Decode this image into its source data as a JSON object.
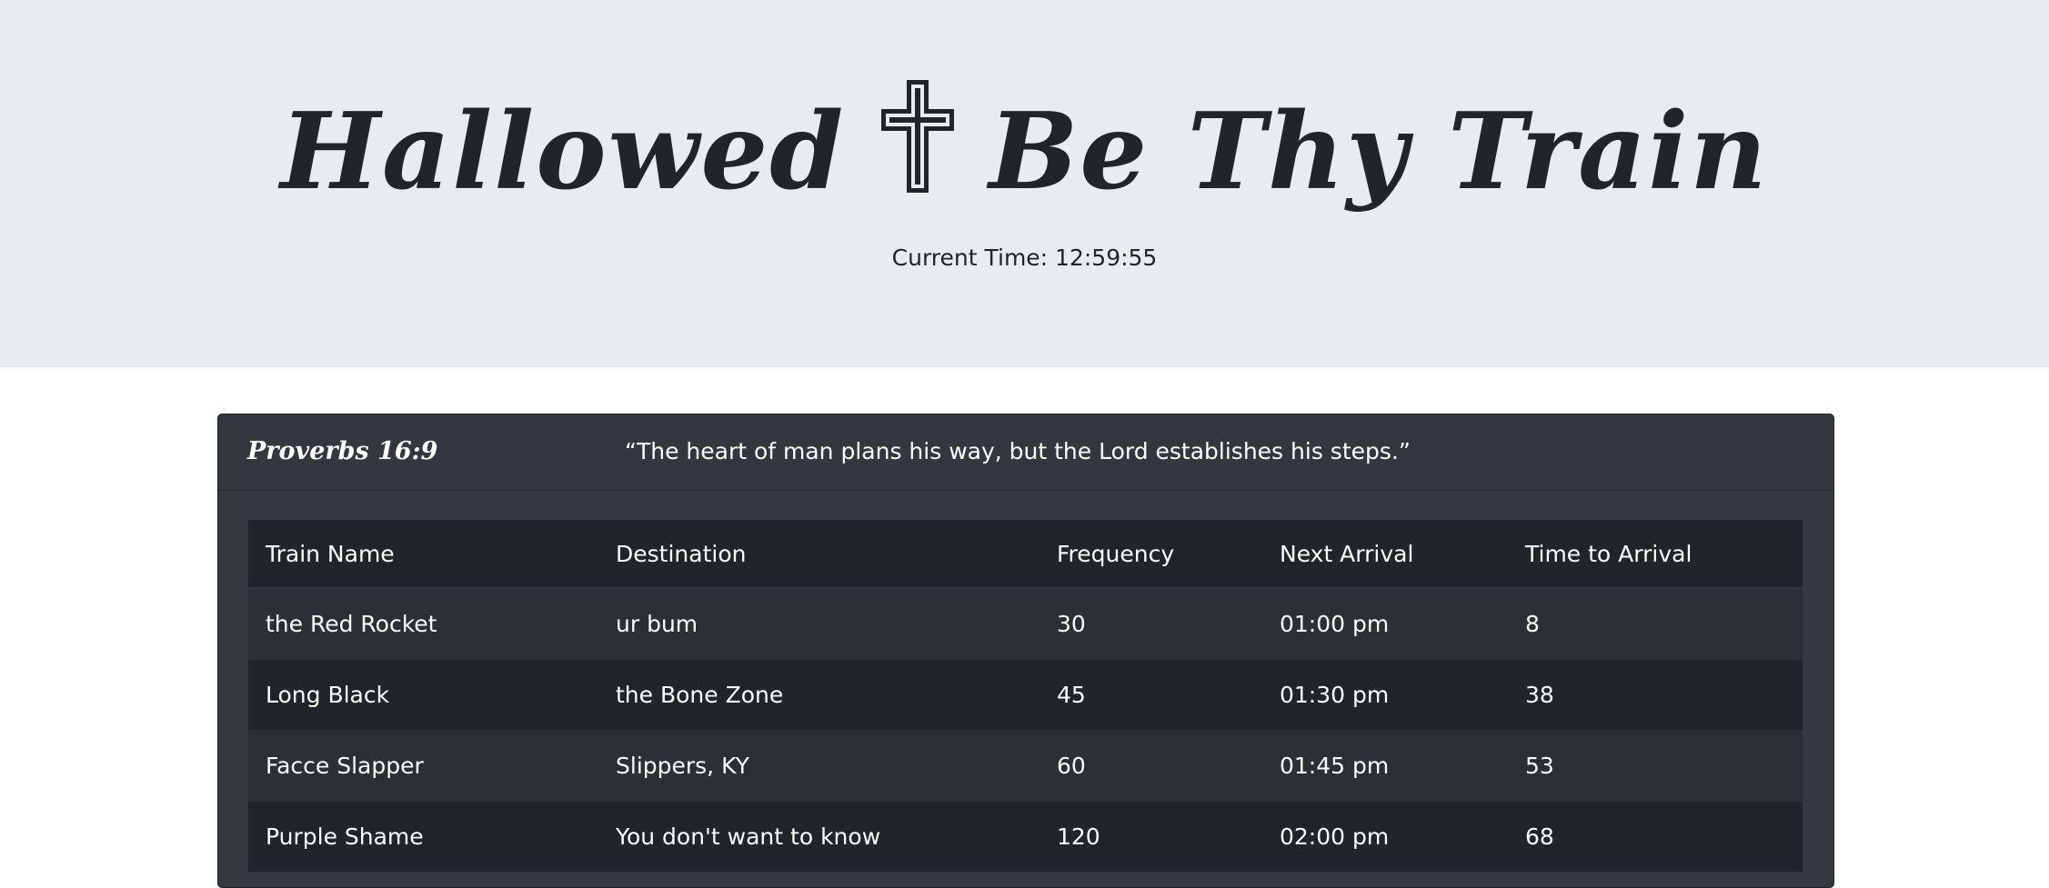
{
  "header": {
    "title_left": "Hallowed",
    "title_right": "Be Thy Train",
    "clock_label": "Current Time: 12:59:55"
  },
  "verse": {
    "reference": "Proverbs 16:9",
    "text": "“The heart of man plans his way, but the Lord establishes his steps.”"
  },
  "table": {
    "columns": [
      "Train Name",
      "Destination",
      "Frequency",
      "Next Arrival",
      "Time to Arrival"
    ],
    "rows": [
      [
        "the Red Rocket",
        "ur bum",
        "30",
        "01:00 pm",
        "8"
      ],
      [
        "Long Black",
        "the Bone Zone",
        "45",
        "01:30 pm",
        "38"
      ],
      [
        "Facce Slapper",
        "Slippers, KY",
        "60",
        "01:45 pm",
        "53"
      ],
      [
        "Purple Shame",
        "You don't want to know",
        "120",
        "02:00 pm",
        "68"
      ]
    ]
  },
  "icons": {
    "title_cross": "latin-cross-icon"
  }
}
